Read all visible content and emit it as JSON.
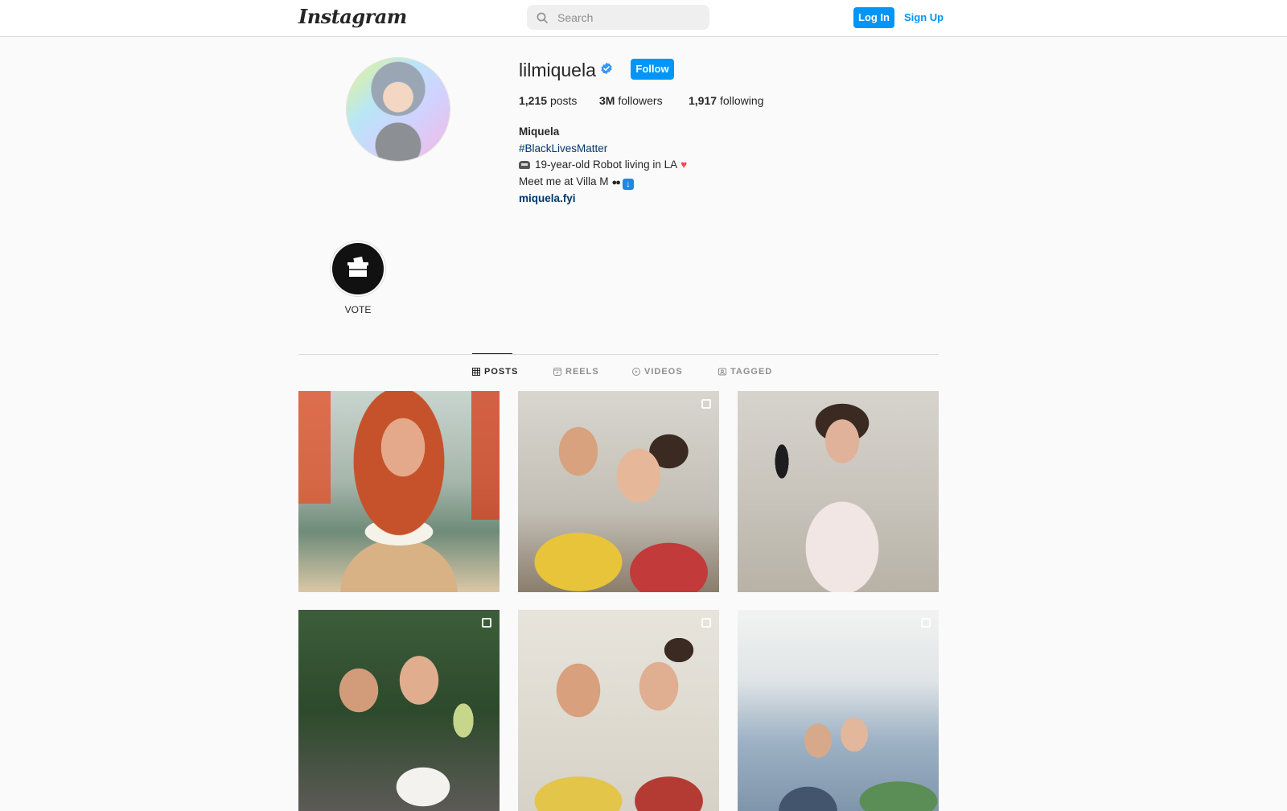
{
  "header": {
    "logo": "Instagram",
    "search_placeholder": "Search",
    "login_label": "Log In",
    "signup_label": "Sign Up"
  },
  "profile": {
    "username": "lilmiquela",
    "follow_label": "Follow",
    "stats": {
      "posts_count": "1,215",
      "posts_label": "posts",
      "followers_count": "3M",
      "followers_label": "followers",
      "following_count": "1,917",
      "following_label": "following"
    },
    "bio": {
      "name": "Miquela",
      "hashtag": "#BlackLivesMatter",
      "line1": "19-year-old Robot living in LA",
      "line2": "Meet me at Villa M",
      "link": "miquela.fyi"
    }
  },
  "highlights": [
    {
      "label": "VOTE"
    }
  ],
  "tabs": [
    {
      "label": "POSTS",
      "icon": "grid-icon",
      "active": true
    },
    {
      "label": "REELS",
      "icon": "reels-icon",
      "active": false
    },
    {
      "label": "VIDEOS",
      "icon": "play-icon",
      "active": false
    },
    {
      "label": "TAGGED",
      "icon": "tag-icon",
      "active": false
    }
  ],
  "colors": {
    "accent": "#0095f6",
    "link": "#00376b",
    "background": "#fafafa"
  }
}
